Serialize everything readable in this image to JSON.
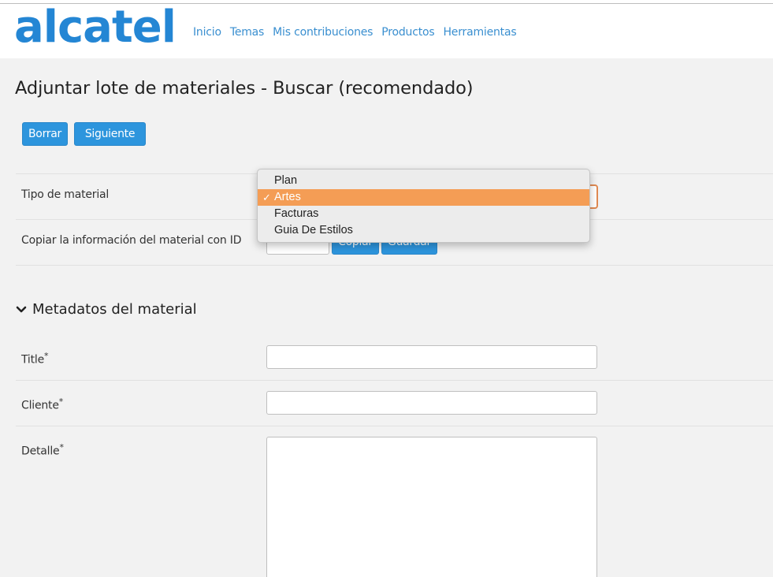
{
  "header": {
    "logo_text": "alcatel",
    "nav": [
      "Inicio",
      "Temas",
      "Mis contribuciones",
      "Productos",
      "Herramientas"
    ]
  },
  "page": {
    "title": "Adjuntar lote de materiales - Buscar (recomendado)"
  },
  "toolbar": {
    "clear_label": "Borrar",
    "next_label": "Siguiente"
  },
  "form": {
    "material_type_label": "Tipo de material",
    "material_type_options": [
      "Plan",
      "Artes",
      "Facturas",
      "Guia De Estilos"
    ],
    "material_type_selected": "Artes",
    "copy_label": "Copiar la información del material con ID",
    "copy_id_value": "",
    "copy_button": "Copiar",
    "save_button": "Guardar"
  },
  "metadata": {
    "section_title": "Metadatos del material",
    "fields": [
      {
        "label": "Title",
        "required": "*",
        "value": ""
      },
      {
        "label": "Cliente",
        "required": "*",
        "value": ""
      },
      {
        "label": "Detalle",
        "required": "*",
        "value": ""
      }
    ]
  },
  "colors": {
    "link": "#3a8fd0",
    "button": "#2d95dd",
    "selected_option": "#f49d55",
    "logo": "#2486d4"
  }
}
